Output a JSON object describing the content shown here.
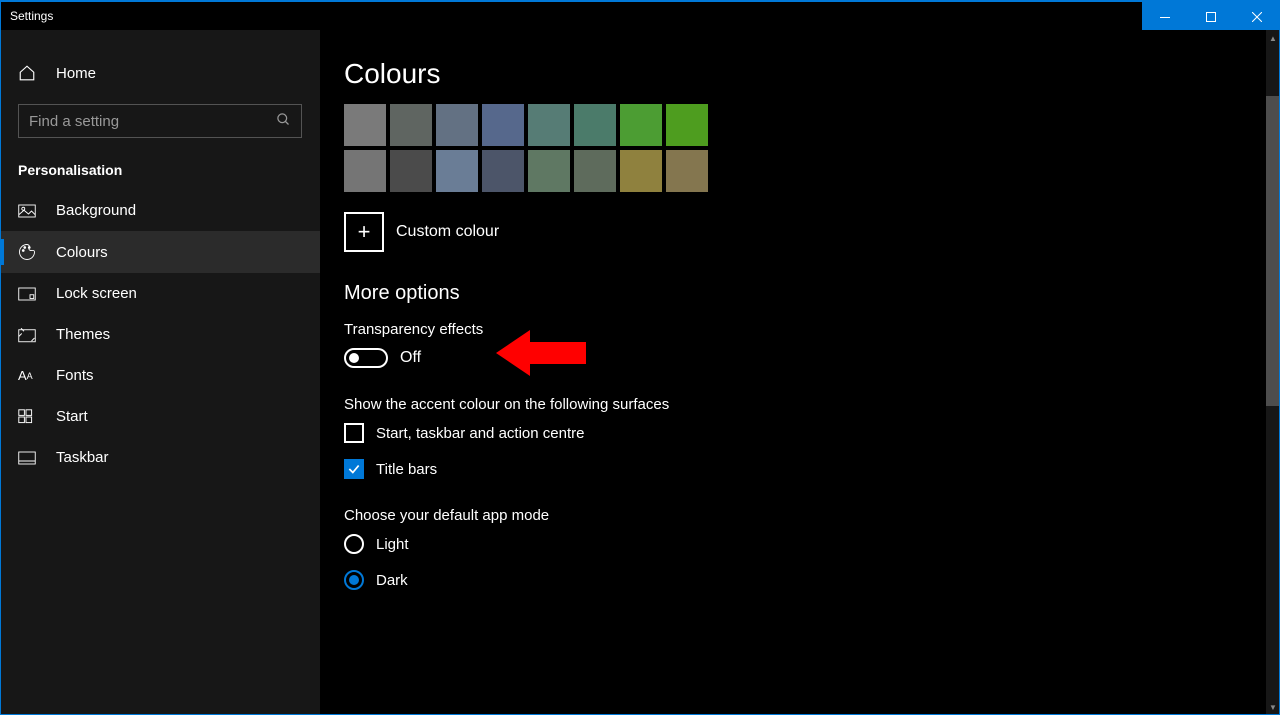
{
  "titlebar": {
    "title": "Settings"
  },
  "sidebar": {
    "home": "Home",
    "search_placeholder": "Find a setting",
    "section": "Personalisation",
    "items": [
      {
        "label": "Background"
      },
      {
        "label": "Colours"
      },
      {
        "label": "Lock screen"
      },
      {
        "label": "Themes"
      },
      {
        "label": "Fonts"
      },
      {
        "label": "Start"
      },
      {
        "label": "Taskbar"
      }
    ]
  },
  "main": {
    "heading": "Colours",
    "swatch_rows": [
      [
        "#7a7a7a",
        "#5f6561",
        "#637183",
        "#56688c",
        "#567c75",
        "#4b7b6a",
        "#4c9d33",
        "#4e9d1f"
      ],
      [
        "#757575",
        "#4b4b4b",
        "#6a7d96",
        "#4c5569",
        "#5f7863",
        "#5e6b5c",
        "#8f813e",
        "#84764f"
      ]
    ],
    "custom_label": "Custom colour",
    "more_options": "More options",
    "transparency_label": "Transparency effects",
    "transparency_state": "Off",
    "accent_surfaces_label": "Show the accent colour on the following surfaces",
    "cb_taskbar": "Start, taskbar and action centre",
    "cb_titlebars": "Title bars",
    "default_mode_label": "Choose your default app mode",
    "radio_light": "Light",
    "radio_dark": "Dark"
  }
}
